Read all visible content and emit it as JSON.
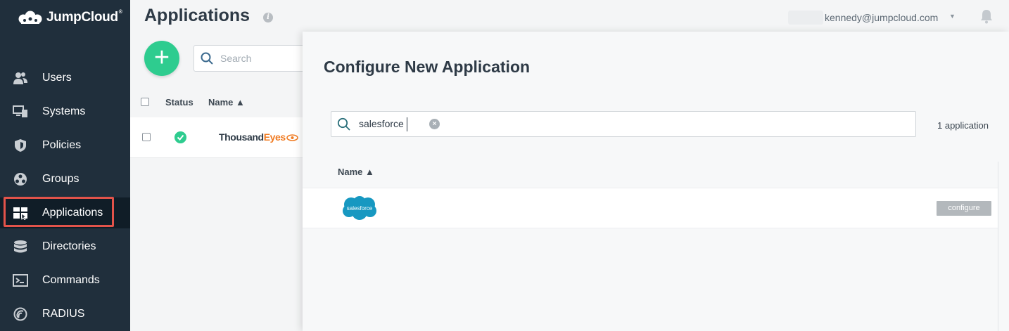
{
  "brand": {
    "name": "JumpCloud",
    "tm": "®",
    "accent": "#2ecc8f",
    "sidebar_bg": "#202f3c",
    "highlight": "#e2534a"
  },
  "sidebar": {
    "items": [
      {
        "label": "Users",
        "icon": "users-icon"
      },
      {
        "label": "Systems",
        "icon": "systems-icon"
      },
      {
        "label": "Policies",
        "icon": "shield-icon"
      },
      {
        "label": "Groups",
        "icon": "groups-icon"
      },
      {
        "label": "Applications",
        "icon": "applications-icon",
        "active": true
      },
      {
        "label": "Directories",
        "icon": "database-icon"
      },
      {
        "label": "Commands",
        "icon": "terminal-icon"
      },
      {
        "label": "RADIUS",
        "icon": "radius-icon"
      }
    ]
  },
  "header": {
    "title": "Applications",
    "info": "i",
    "user_email": "kennedy@jumpcloud.com",
    "caret": "▼"
  },
  "list": {
    "add_label": "+",
    "search_placeholder": "Search",
    "columns": {
      "status": "Status",
      "name": "Name ▲"
    },
    "rows": [
      {
        "app_part1": "Thousand",
        "app_part2": "Eyes",
        "status": "active"
      }
    ]
  },
  "panel": {
    "title": "Configure New Application",
    "search_value": "salesforce",
    "clear": "×",
    "count": "1 application",
    "name_column": "Name ▲",
    "results": [
      {
        "logo_text": "salesforce",
        "action": "configure"
      }
    ]
  }
}
